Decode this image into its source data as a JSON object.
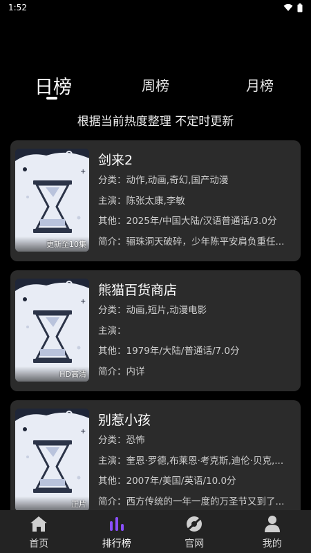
{
  "status_bar": {
    "time": "1:52"
  },
  "tabs": [
    {
      "label": "日榜",
      "active": true
    },
    {
      "label": "周榜",
      "active": false
    },
    {
      "label": "月榜",
      "active": false
    }
  ],
  "subtitle": "根据当前热度整理 不定时更新",
  "cards": [
    {
      "title": "剑来2",
      "badge": "更新至10集",
      "category": "分类：动作,动画,奇幻,国产动漫",
      "cast": "主演：陈张太康,李敏",
      "other": "其他：2025年/中国大陆/汉语普通话/3.0分",
      "intro": "简介：骊珠洞天破碎，少年陈平安肩负重任..."
    },
    {
      "title": "熊猫百货商店",
      "badge": "HD高清",
      "category": "分类：动画,短片,动漫电影",
      "cast": "主演：",
      "other": "其他：1979年/大陆/普通话/7.0分",
      "intro": "简介：内详"
    },
    {
      "title": "别惹小孩",
      "badge": "正片",
      "category": "分类：恐怖",
      "cast": "主演：奎恩·罗德,布莱恩·考克斯,迪伦·贝克,...",
      "other": "其他：2007年/美国/英语/10.0分",
      "intro": "简介：西方传统的一年一度的万圣节又到了..."
    }
  ],
  "bottom_nav": [
    {
      "label": "首页",
      "icon": "home-icon",
      "active": false
    },
    {
      "label": "排行榜",
      "icon": "ranking-icon",
      "active": true
    },
    {
      "label": "官网",
      "icon": "website-icon",
      "active": false
    },
    {
      "label": "我的",
      "icon": "profile-icon",
      "active": false
    }
  ],
  "colors": {
    "accent": "#8a4fff",
    "card_bg": "#2b2b2b",
    "background": "#000000"
  }
}
